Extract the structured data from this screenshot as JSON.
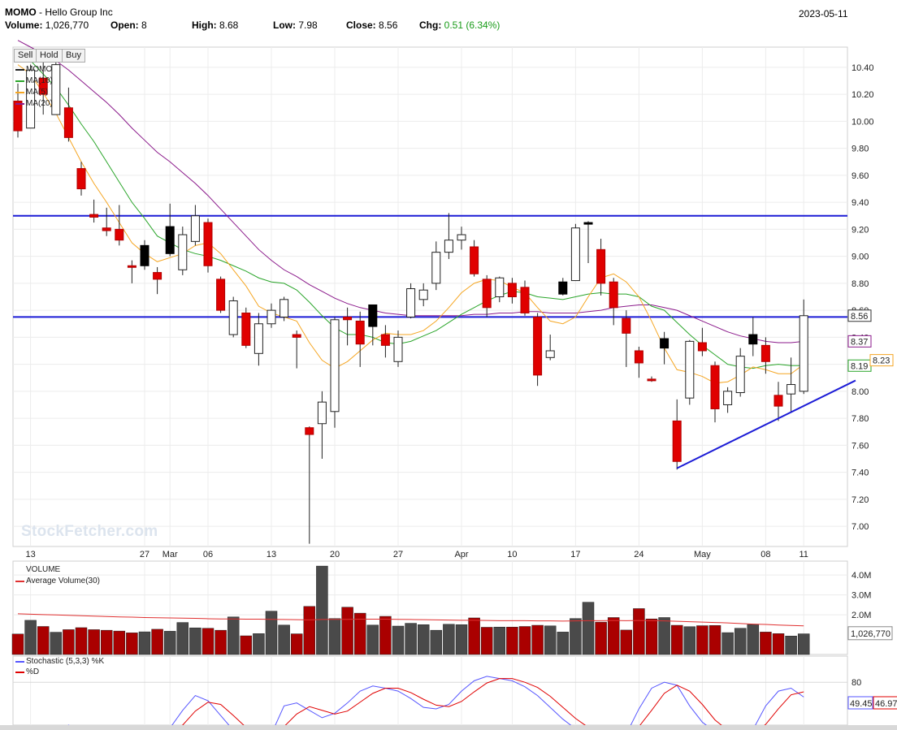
{
  "header": {
    "symbol": "MOMO",
    "company": "Hello Group Inc",
    "date": "2023-05-11",
    "volume_label": "Volume:",
    "volume": "1,026,770",
    "open_label": "Open:",
    "open": "8",
    "high_label": "High:",
    "high": "8.68",
    "low_label": "Low:",
    "low": "7.98",
    "close_label": "Close:",
    "close": "8.56",
    "chg_label": "Chg:",
    "chg": "0.51 (6.34%)",
    "chg_color": "#1a9c1a"
  },
  "toolbar": {
    "sell": "Sell",
    "hold": "Hold",
    "buy": "Buy"
  },
  "watermark": "StockFetcher.com",
  "legend": {
    "price": [
      "MOMO",
      "MA(10)",
      "MA(5)",
      "MA(20)"
    ],
    "volume": [
      "VOLUME",
      "Average Volume(30)"
    ],
    "stoch": [
      "Stochastic (5,3,3) %K",
      "%D"
    ]
  },
  "colors": {
    "up": "#ffffff",
    "down": "#e00000",
    "black_candle": "#000000",
    "ma5": "#f5a623",
    "ma10": "#2aa52a",
    "ma20": "#8b1a8b",
    "trend": "#1c1cd6",
    "vol_up": "#4a4a4a",
    "vol_down": "#aa0000",
    "avgvol": "#e03030",
    "k": "#5555ff",
    "d": "#e00000"
  },
  "chart_data": {
    "type": "candlestick",
    "price_axis": {
      "ticks": [
        "10.40",
        "10.20",
        "10.00",
        "9.80",
        "9.60",
        "9.40",
        "9.20",
        "9.00",
        "8.80",
        "8.60",
        "8.40",
        "8.20",
        "8.00",
        "7.80",
        "7.60",
        "7.40",
        "7.20",
        "7.00"
      ],
      "range": [
        6.85,
        10.55
      ]
    },
    "x_labels": [
      "13",
      "27",
      "Mar",
      "06",
      "13",
      "20",
      "27",
      "Apr",
      "10",
      "17",
      "24",
      "May",
      "08",
      "11"
    ],
    "candles": [
      {
        "o": 10.15,
        "h": 10.28,
        "l": 9.88,
        "c": 9.93,
        "k": "down"
      },
      {
        "o": 9.95,
        "h": 10.42,
        "l": 9.95,
        "c": 10.38,
        "k": "up"
      },
      {
        "o": 10.32,
        "h": 10.44,
        "l": 10.05,
        "c": 10.2,
        "k": "down"
      },
      {
        "o": 10.05,
        "h": 10.44,
        "l": 10.05,
        "c": 10.42,
        "k": "up"
      },
      {
        "o": 10.1,
        "h": 10.25,
        "l": 9.85,
        "c": 9.88,
        "k": "down"
      },
      {
        "o": 9.65,
        "h": 9.7,
        "l": 9.45,
        "c": 9.5,
        "k": "down"
      },
      {
        "o": 9.31,
        "h": 9.42,
        "l": 9.25,
        "c": 9.29,
        "k": "down"
      },
      {
        "o": 9.21,
        "h": 9.36,
        "l": 9.15,
        "c": 9.19,
        "k": "down"
      },
      {
        "o": 9.2,
        "h": 9.38,
        "l": 9.08,
        "c": 9.12,
        "k": "down"
      },
      {
        "o": 8.93,
        "h": 8.97,
        "l": 8.8,
        "c": 8.92,
        "k": "down"
      },
      {
        "o": 8.93,
        "h": 9.12,
        "l": 8.9,
        "c": 9.08,
        "k": "black"
      },
      {
        "o": 8.88,
        "h": 8.92,
        "l": 8.72,
        "c": 8.83,
        "k": "down"
      },
      {
        "o": 9.02,
        "h": 9.39,
        "l": 9.0,
        "c": 9.22,
        "k": "black"
      },
      {
        "o": 8.9,
        "h": 9.22,
        "l": 8.86,
        "c": 9.16,
        "k": "up"
      },
      {
        "o": 9.11,
        "h": 9.38,
        "l": 9.08,
        "c": 9.3,
        "k": "up"
      },
      {
        "o": 9.25,
        "h": 9.28,
        "l": 8.88,
        "c": 8.93,
        "k": "down"
      },
      {
        "o": 8.83,
        "h": 8.85,
        "l": 8.58,
        "c": 8.6,
        "k": "down"
      },
      {
        "o": 8.42,
        "h": 8.7,
        "l": 8.4,
        "c": 8.67,
        "k": "up"
      },
      {
        "o": 8.58,
        "h": 8.62,
        "l": 8.32,
        "c": 8.34,
        "k": "down"
      },
      {
        "o": 8.28,
        "h": 8.58,
        "l": 8.19,
        "c": 8.5,
        "k": "up"
      },
      {
        "o": 8.5,
        "h": 8.65,
        "l": 8.47,
        "c": 8.6,
        "k": "up"
      },
      {
        "o": 8.55,
        "h": 8.7,
        "l": 8.52,
        "c": 8.68,
        "k": "up"
      },
      {
        "o": 8.42,
        "h": 8.45,
        "l": 8.17,
        "c": 8.4,
        "k": "down"
      },
      {
        "o": 7.73,
        "h": 7.74,
        "l": 6.87,
        "c": 7.68,
        "k": "down"
      },
      {
        "o": 7.76,
        "h": 8.0,
        "l": 7.5,
        "c": 7.92,
        "k": "up"
      },
      {
        "o": 7.85,
        "h": 8.55,
        "l": 7.73,
        "c": 8.53,
        "k": "up"
      },
      {
        "o": 8.55,
        "h": 8.62,
        "l": 8.34,
        "c": 8.53,
        "k": "down"
      },
      {
        "o": 8.52,
        "h": 8.59,
        "l": 8.18,
        "c": 8.35,
        "k": "down"
      },
      {
        "o": 8.48,
        "h": 8.64,
        "l": 8.34,
        "c": 8.64,
        "k": "black"
      },
      {
        "o": 8.42,
        "h": 8.49,
        "l": 8.25,
        "c": 8.34,
        "k": "down"
      },
      {
        "o": 8.22,
        "h": 8.45,
        "l": 8.18,
        "c": 8.4,
        "k": "up"
      },
      {
        "o": 8.55,
        "h": 8.8,
        "l": 8.54,
        "c": 8.76,
        "k": "up"
      },
      {
        "o": 8.68,
        "h": 8.8,
        "l": 8.63,
        "c": 8.75,
        "k": "up"
      },
      {
        "o": 8.8,
        "h": 9.11,
        "l": 8.75,
        "c": 9.03,
        "k": "up"
      },
      {
        "o": 9.03,
        "h": 9.32,
        "l": 8.98,
        "c": 9.12,
        "k": "up"
      },
      {
        "o": 9.12,
        "h": 9.22,
        "l": 9.05,
        "c": 9.16,
        "k": "up"
      },
      {
        "o": 9.07,
        "h": 9.12,
        "l": 8.85,
        "c": 8.87,
        "k": "down"
      },
      {
        "o": 8.83,
        "h": 8.86,
        "l": 8.55,
        "c": 8.62,
        "k": "down"
      },
      {
        "o": 8.7,
        "h": 8.85,
        "l": 8.66,
        "c": 8.84,
        "k": "up"
      },
      {
        "o": 8.8,
        "h": 8.84,
        "l": 8.65,
        "c": 8.7,
        "k": "down"
      },
      {
        "o": 8.77,
        "h": 8.82,
        "l": 8.56,
        "c": 8.58,
        "k": "down"
      },
      {
        "o": 8.55,
        "h": 8.58,
        "l": 8.04,
        "c": 8.12,
        "k": "down"
      },
      {
        "o": 8.25,
        "h": 8.42,
        "l": 8.23,
        "c": 8.3,
        "k": "up"
      },
      {
        "o": 8.72,
        "h": 8.84,
        "l": 8.71,
        "c": 8.81,
        "k": "black"
      },
      {
        "o": 8.82,
        "h": 9.24,
        "l": 8.82,
        "c": 9.21,
        "k": "up"
      },
      {
        "o": 9.24,
        "h": 9.26,
        "l": 8.95,
        "c": 9.25,
        "k": "black"
      },
      {
        "o": 9.05,
        "h": 9.13,
        "l": 8.71,
        "c": 8.8,
        "k": "down"
      },
      {
        "o": 8.81,
        "h": 8.84,
        "l": 8.49,
        "c": 8.62,
        "k": "down"
      },
      {
        "o": 8.54,
        "h": 8.6,
        "l": 8.18,
        "c": 8.43,
        "k": "down"
      },
      {
        "o": 8.3,
        "h": 8.33,
        "l": 8.1,
        "c": 8.21,
        "k": "down"
      },
      {
        "o": 8.09,
        "h": 8.11,
        "l": 8.07,
        "c": 8.09,
        "k": "down"
      },
      {
        "o": 8.39,
        "h": 8.44,
        "l": 8.2,
        "c": 8.32,
        "k": "black"
      },
      {
        "o": 7.78,
        "h": 7.94,
        "l": 7.42,
        "c": 7.48,
        "k": "down"
      },
      {
        "o": 7.95,
        "h": 8.38,
        "l": 7.9,
        "c": 8.37,
        "k": "up"
      },
      {
        "o": 8.36,
        "h": 8.47,
        "l": 8.26,
        "c": 8.3,
        "k": "down"
      },
      {
        "o": 8.19,
        "h": 8.22,
        "l": 7.77,
        "c": 7.87,
        "k": "down"
      },
      {
        "o": 7.9,
        "h": 8.03,
        "l": 7.84,
        "c": 8.0,
        "k": "up"
      },
      {
        "o": 7.99,
        "h": 8.32,
        "l": 7.96,
        "c": 8.26,
        "k": "up"
      },
      {
        "o": 8.35,
        "h": 8.55,
        "l": 8.26,
        "c": 8.42,
        "k": "black"
      },
      {
        "o": 8.34,
        "h": 8.4,
        "l": 8.13,
        "c": 8.22,
        "k": "down"
      },
      {
        "o": 7.97,
        "h": 8.07,
        "l": 7.78,
        "c": 7.89,
        "k": "down"
      },
      {
        "o": 7.98,
        "h": 8.25,
        "l": 7.84,
        "c": 8.05,
        "k": "up"
      },
      {
        "o": 8.0,
        "h": 8.68,
        "l": 7.98,
        "c": 8.56,
        "k": "up"
      }
    ],
    "ma5": [
      10.42,
      10.35,
      10.21,
      10.06,
      9.88,
      9.7,
      9.54,
      9.4,
      9.25,
      9.1,
      9.02,
      8.96,
      8.99,
      9.02,
      9.08,
      9.1,
      9.02,
      8.9,
      8.78,
      8.63,
      8.58,
      8.55,
      8.52,
      8.36,
      8.23,
      8.17,
      8.22,
      8.3,
      8.38,
      8.43,
      8.42,
      8.42,
      8.45,
      8.52,
      8.62,
      8.73,
      8.8,
      8.83,
      8.82,
      8.77,
      8.73,
      8.62,
      8.52,
      8.5,
      8.55,
      8.7,
      8.84,
      8.87,
      8.81,
      8.7,
      8.52,
      8.32,
      8.16,
      8.14,
      8.11,
      8.06,
      8.07,
      8.12,
      8.18,
      8.16,
      8.13,
      8.13,
      8.2
    ],
    "ma10": [
      10.5,
      10.45,
      10.35,
      10.25,
      10.12,
      9.98,
      9.85,
      9.7,
      9.55,
      9.4,
      9.28,
      9.15,
      9.1,
      9.05,
      9.02,
      9.0,
      8.97,
      8.93,
      8.89,
      8.84,
      8.81,
      8.8,
      8.75,
      8.66,
      8.56,
      8.47,
      8.42,
      8.42,
      8.4,
      8.36,
      8.35,
      8.37,
      8.41,
      8.45,
      8.51,
      8.57,
      8.62,
      8.67,
      8.71,
      8.74,
      8.73,
      8.7,
      8.69,
      8.68,
      8.7,
      8.72,
      8.73,
      8.72,
      8.72,
      8.7,
      8.63,
      8.6,
      8.51,
      8.42,
      8.34,
      8.27,
      8.2,
      8.18,
      8.17,
      8.19,
      8.2,
      8.19,
      8.19
    ],
    "ma20": [
      10.6,
      10.55,
      10.5,
      10.45,
      10.38,
      10.3,
      10.22,
      10.14,
      10.05,
      9.95,
      9.86,
      9.77,
      9.7,
      9.62,
      9.54,
      9.45,
      9.35,
      9.25,
      9.15,
      9.05,
      8.97,
      8.9,
      8.85,
      8.79,
      8.74,
      8.69,
      8.65,
      8.62,
      8.6,
      8.58,
      8.57,
      8.56,
      8.56,
      8.56,
      8.56,
      8.56,
      8.57,
      8.57,
      8.58,
      8.58,
      8.59,
      8.59,
      8.58,
      8.58,
      8.58,
      8.59,
      8.6,
      8.62,
      8.63,
      8.64,
      8.64,
      8.62,
      8.6,
      8.56,
      8.52,
      8.48,
      8.44,
      8.41,
      8.39,
      8.37,
      8.36,
      8.36,
      8.37
    ],
    "hlines": [
      9.3,
      8.55
    ],
    "trendline": [
      {
        "i": 52,
        "p": 7.43
      },
      {
        "i": 65,
        "p": 8.05
      }
    ],
    "price_labels": [
      {
        "text": "8.56",
        "value": 8.56,
        "color": "#333"
      },
      {
        "text": "8.37",
        "value": 8.37,
        "color": "#8b1a8b"
      },
      {
        "text": "8.19",
        "value": 8.19,
        "color": "#2aa52a"
      },
      {
        "text": "8.23",
        "value": 8.23,
        "color": "#f5a623"
      }
    ],
    "volume_axis": {
      "ticks": [
        "4.0M",
        "3.0M",
        "2.0M"
      ],
      "range": [
        0,
        4.7
      ]
    },
    "volume": [
      1.03,
      1.72,
      1.41,
      1.12,
      1.25,
      1.35,
      1.25,
      1.22,
      1.18,
      1.09,
      1.14,
      1.27,
      1.17,
      1.61,
      1.34,
      1.32,
      1.22,
      1.89,
      0.94,
      1.05,
      2.18,
      1.48,
      1.04,
      2.42,
      4.45,
      1.81,
      2.38,
      2.08,
      1.48,
      1.92,
      1.43,
      1.57,
      1.5,
      1.22,
      1.52,
      1.5,
      1.84,
      1.37,
      1.38,
      1.38,
      1.41,
      1.47,
      1.44,
      1.13,
      1.81,
      2.63,
      1.63,
      1.86,
      1.23,
      2.31,
      1.79,
      1.86,
      1.47,
      1.4,
      1.45,
      1.46,
      1.1,
      1.32,
      1.51,
      1.13,
      1.05,
      0.93,
      1.04,
      1.28,
      1.03,
      1.03
    ],
    "avg_volume": [
      2.05,
      2.03,
      2.01,
      1.99,
      1.97,
      1.95,
      1.93,
      1.91,
      1.89,
      1.88,
      1.86,
      1.85,
      1.84,
      1.83,
      1.82,
      1.8,
      1.79,
      1.79,
      1.78,
      1.78,
      1.77,
      1.76,
      1.75,
      1.74,
      1.76,
      1.77,
      1.77,
      1.78,
      1.78,
      1.78,
      1.77,
      1.76,
      1.75,
      1.74,
      1.73,
      1.72,
      1.72,
      1.71,
      1.7,
      1.7,
      1.7,
      1.69,
      1.69,
      1.68,
      1.69,
      1.7,
      1.7,
      1.71,
      1.7,
      1.71,
      1.7,
      1.69,
      1.67,
      1.65,
      1.63,
      1.61,
      1.59,
      1.56,
      1.53,
      1.51,
      1.48,
      1.46,
      1.44,
      1.43,
      1.42,
      1.42
    ],
    "volume_label": "1,026,770",
    "stoch_axis": {
      "ticks": [
        "80"
      ],
      "range": [
        0,
        100
      ]
    },
    "stoch_k": [
      10,
      7,
      5,
      8,
      22,
      12,
      8,
      3,
      2,
      4,
      9,
      6,
      18,
      42,
      62,
      55,
      35,
      15,
      6,
      2,
      10,
      48,
      52,
      42,
      32,
      38,
      52,
      68,
      75,
      72,
      68,
      58,
      46,
      44,
      50,
      68,
      82,
      88,
      85,
      82,
      74,
      62,
      46,
      30,
      17,
      10,
      7,
      5,
      10,
      44,
      72,
      80,
      76,
      48,
      26,
      13,
      6,
      4,
      16,
      48,
      68,
      72,
      60,
      58,
      52,
      40,
      28,
      34
    ],
    "stoch_d": [
      9,
      8,
      7,
      6,
      12,
      14,
      14,
      10,
      5,
      3,
      5,
      6,
      11,
      22,
      41,
      53,
      50,
      35,
      19,
      8,
      6,
      20,
      37,
      47,
      42,
      37,
      41,
      53,
      65,
      72,
      72,
      66,
      57,
      49,
      47,
      54,
      67,
      79,
      85,
      85,
      80,
      73,
      61,
      46,
      31,
      19,
      11,
      7,
      7,
      20,
      42,
      65,
      76,
      68,
      50,
      29,
      15,
      8,
      9,
      23,
      44,
      63,
      67,
      63,
      57,
      50,
      40,
      34
    ],
    "stoch_labels": [
      {
        "text": "49.45",
        "value": 49.45
      },
      {
        "text": "46.97",
        "value": 46.97
      }
    ]
  }
}
